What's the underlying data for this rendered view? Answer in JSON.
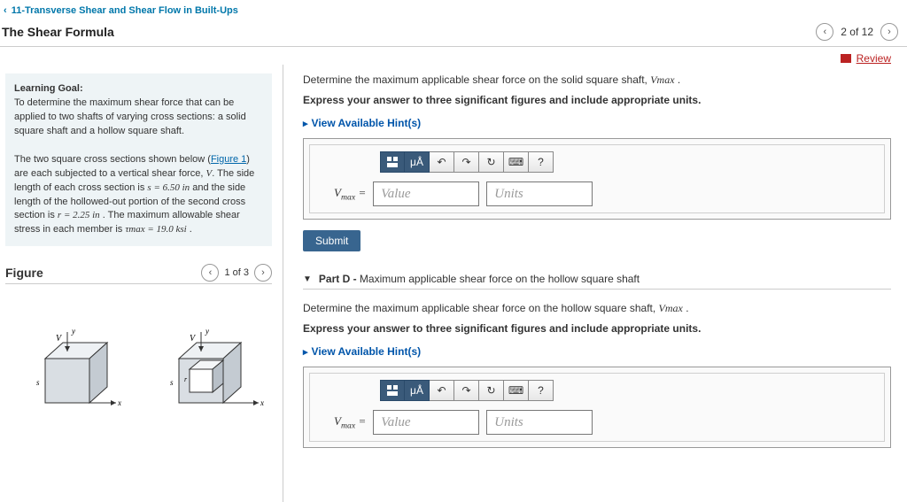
{
  "breadcrumb": "11-Transverse Shear and Shear Flow in Built-Ups",
  "title": "The Shear Formula",
  "pager": {
    "text": "2 of 12"
  },
  "review": "Review",
  "left": {
    "goal_label": "Learning Goal:",
    "goal_text": "To determine the maximum shear force that can be applied to two shafts of varying cross sections: a solid square shaft and a hollow square shaft.",
    "figure_link": "Figure 1",
    "desc_pre": "The two square cross sections shown below (",
    "desc_post1": ") are each subjected to a vertical shear force, ",
    "desc_V": "V",
    "desc_post2": ". The side length of each cross section is ",
    "s_eq": "s = 6.50 in",
    "desc_post3": " and the side length of the hollowed-out portion of the second cross section is ",
    "r_eq": "r = 2.25 in",
    "desc_post4": " . The maximum allowable shear stress in each member is ",
    "tau_eq": "τmax = 19.0 ksi",
    "desc_end": " .",
    "figure_label": "Figure",
    "figure_pager": "1 of 3"
  },
  "partC": {
    "prompt1_a": "Determine the maximum applicable shear force on the solid square shaft, ",
    "prompt1_b": "Vmax",
    "prompt1_c": " .",
    "prompt2": "Express your answer to three significant figures and include appropriate units.",
    "hints": "View Available Hint(s)",
    "toolbar_mu": "μÅ",
    "toolbar_q": "?",
    "lhs": "Vmax =",
    "value_ph": "Value",
    "units_ph": "Units",
    "submit": "Submit"
  },
  "partD": {
    "header_a": "Part D - ",
    "header_b": "Maximum applicable shear force on the hollow square shaft",
    "prompt1_a": "Determine the maximum applicable shear force on the hollow square shaft, ",
    "prompt1_b": "Vmax",
    "prompt1_c": " .",
    "prompt2": "Express your answer to three significant figures and include appropriate units.",
    "hints": "View Available Hint(s)",
    "lhs": "Vmax =",
    "value_ph": "Value",
    "units_ph": "Units"
  }
}
